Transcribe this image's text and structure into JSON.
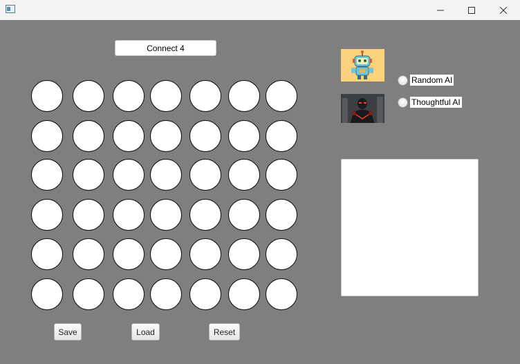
{
  "window": {
    "app_icon": "window-app-icon",
    "controls": [
      "minimize-icon",
      "maximize-icon",
      "close-icon"
    ]
  },
  "game": {
    "title": "Connect 4",
    "rows": 6,
    "columns": 7
  },
  "buttons": {
    "save": "Save",
    "load": "Load",
    "reset": "Reset"
  },
  "opponents": [
    {
      "label": "Random AI",
      "selected": false,
      "avatar": "robot-avatar"
    },
    {
      "label": "Thoughtful AI",
      "selected": false,
      "avatar": "cyborg-avatar"
    }
  ],
  "colors": {
    "background": "#7f7f7f",
    "cell": "#ffffff",
    "robot_avatar_bg": "#fcd27c"
  },
  "log": ""
}
